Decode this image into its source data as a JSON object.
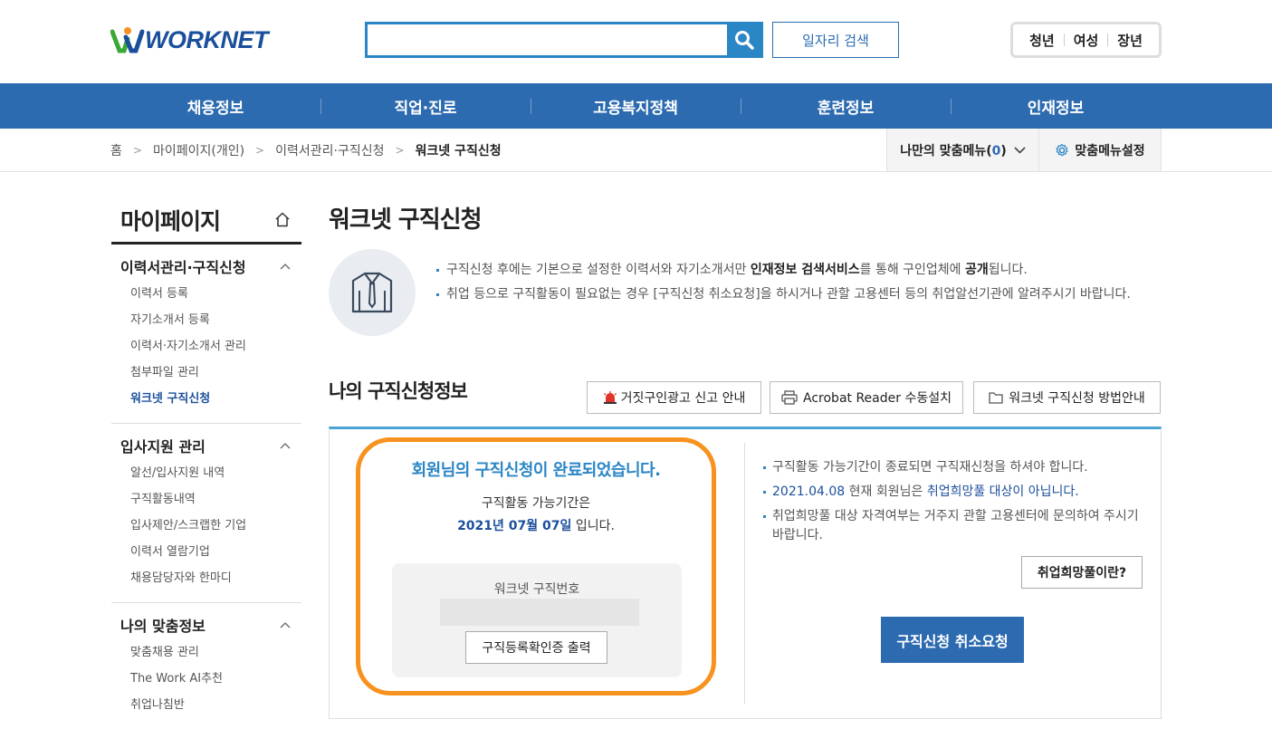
{
  "header": {
    "logo_text": "WORKNET",
    "search_placeholder": "",
    "job_search_label": "일자리 검색",
    "quick_links": [
      "청년",
      "여성",
      "장년"
    ]
  },
  "gnb": [
    "채용정보",
    "직업·진로",
    "고용복지정책",
    "훈련정보",
    "인재정보"
  ],
  "breadcrumb": {
    "items": [
      "홈",
      "마이페이지(개인)",
      "이력서관리·구직신청"
    ],
    "current": "워크넷 구직신청"
  },
  "mymenu": {
    "label": "나만의 맞춤메뉴",
    "count_open": "(",
    "count": "0",
    "count_close": ")"
  },
  "menu_settings": "맞춤메뉴설정",
  "lnb": {
    "title": "마이페이지",
    "groups": [
      {
        "title": "이력서관리·구직신청",
        "items": [
          "이력서 등록",
          "자기소개서 등록",
          "이력서·자기소개서 관리",
          "첨부파일 관리",
          "워크넷 구직신청"
        ]
      },
      {
        "title": "입사지원 관리",
        "items": [
          "알선/입사지원 내역",
          "구직활동내역",
          "입사제안/스크랩한 기업",
          "이력서 열람기업",
          "채용담당자와 한마디"
        ]
      },
      {
        "title": "나의 맞춤정보",
        "items": [
          "맞춤채용 관리",
          "The Work AI추천",
          "취업나침반"
        ]
      }
    ]
  },
  "main": {
    "title": "워크넷 구직신청",
    "intro": {
      "line1_a": "구직신청 후에는 기본으로 설정한 이력서와 자기소개서만 ",
      "line1_b": "인재정보 검색서비스",
      "line1_c": "를 통해 구인업체에 ",
      "line1_d": "공개",
      "line1_e": "됩니다.",
      "line2": "취업 등으로 구직활동이 필요없는 경우 [구직신청 취소요청]을 하시거나 관할 고용센터 등의 취업알선기관에 알려주시기 바랍니다."
    },
    "section_title": "나의 구직신청정보",
    "buttons": {
      "fake_ad": "거짓구인광고 신고 안내",
      "acrobat": "Acrobat Reader 수동설치",
      "guide": "워크넷 구직신청 방법안내"
    },
    "status": {
      "complete_msg": "회원님의 구직신청이 완료되었습니다.",
      "period_label": "구직활동 가능기간은",
      "period_date": "2021년 07월 07일",
      "period_suffix": " 입니다.",
      "jobno_label": "워크넷 구직번호",
      "print_btn": "구직등록확인증 출력"
    },
    "notices": {
      "n1": "구직활동 가능기간이 종료되면 구직재신청을 하셔야 합니다.",
      "n2_date": "2021.04.08",
      "n2_mid": " 현재 회원님은 ",
      "n2_status": "취업희망풀 대상이 아닙니다.",
      "n3": "취업희망풀 대상 자격여부는 거주지 관할 고용센터에 문의하여 주시기 바랍니다."
    },
    "pool_btn": "취업희망풀이란?",
    "cancel_btn": "구직신청 취소요청"
  }
}
